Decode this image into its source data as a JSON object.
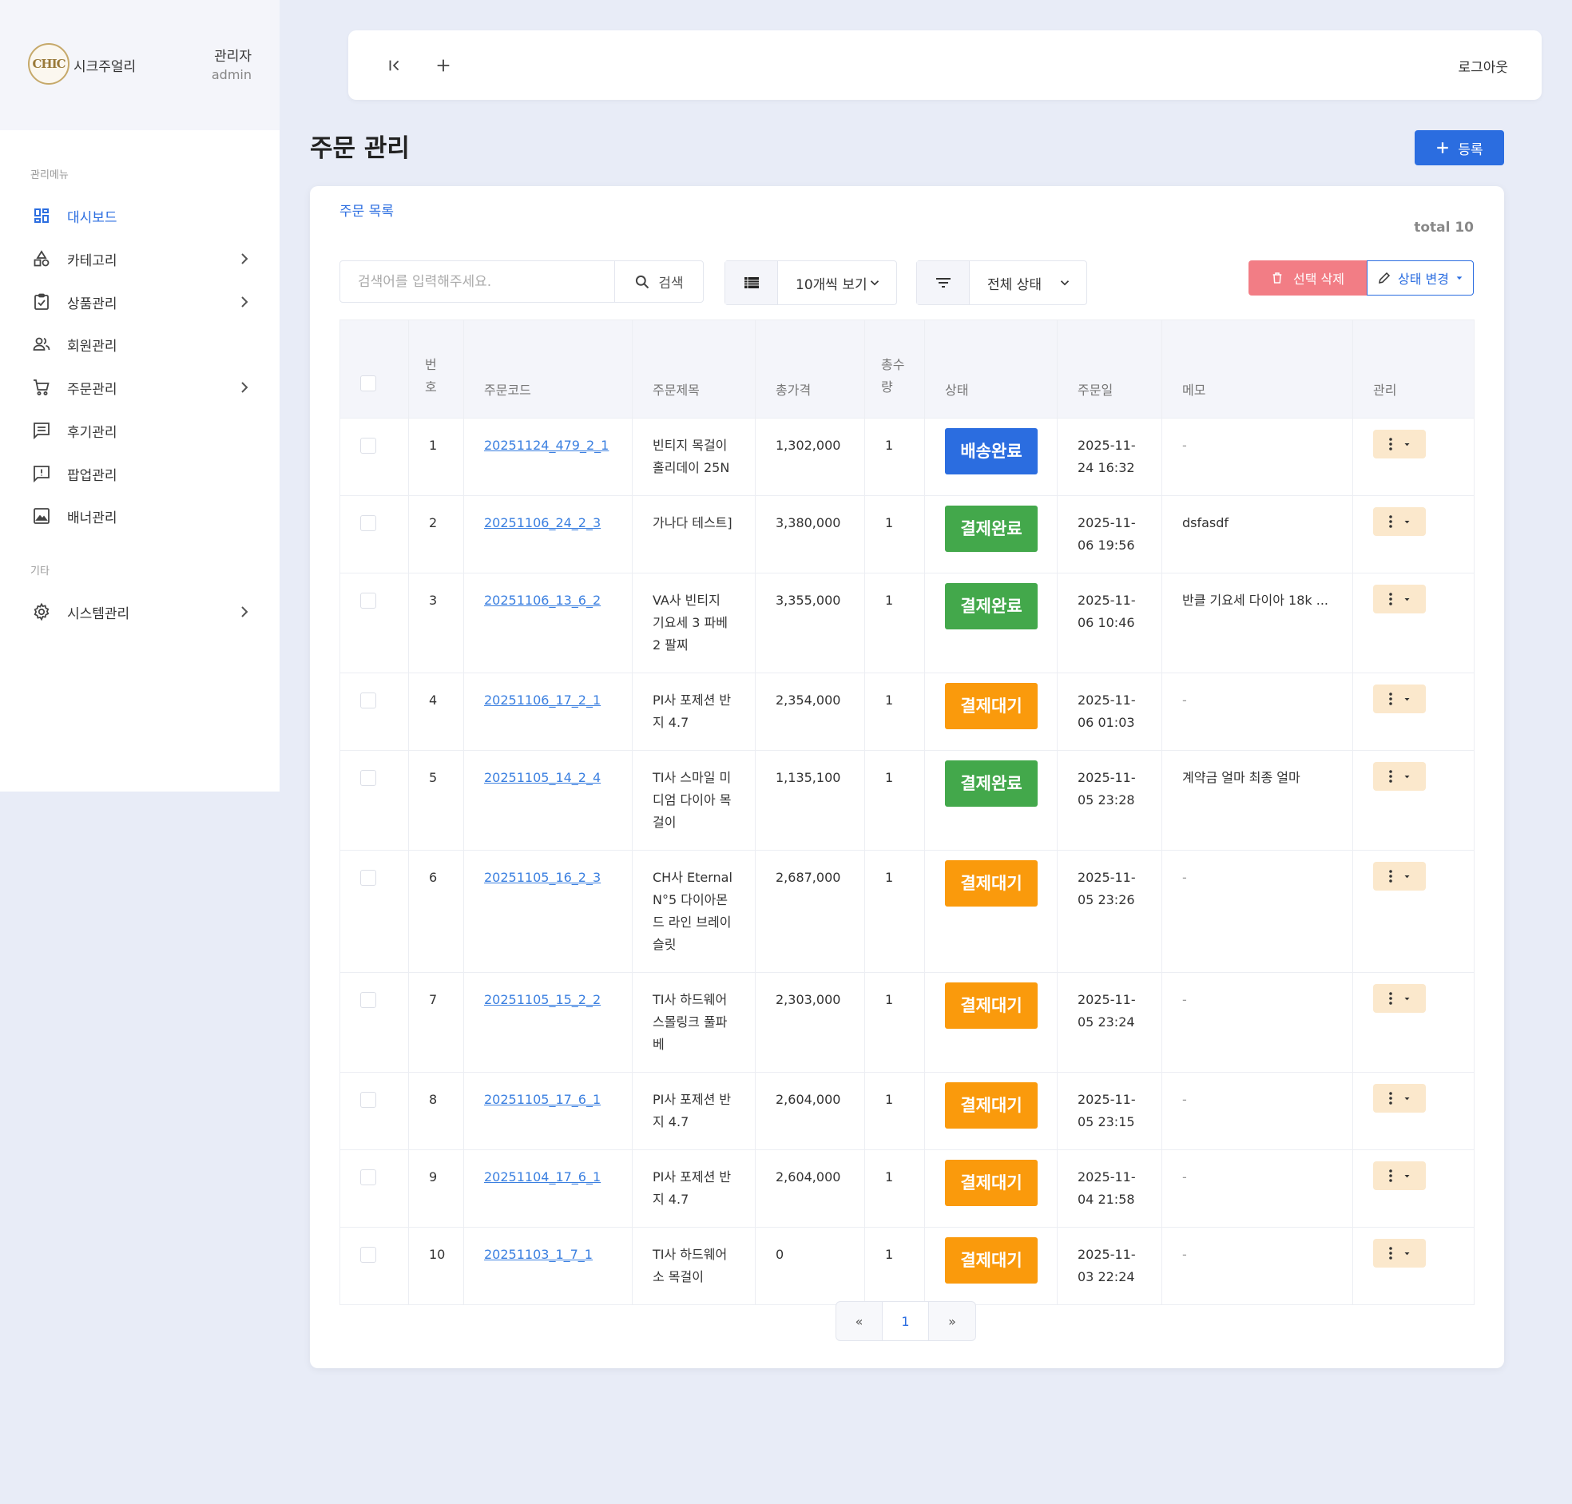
{
  "brand": {
    "logo_text": "CHIC",
    "name": "시크주얼리"
  },
  "user": {
    "role": "관리자",
    "id": "admin"
  },
  "sidebar": {
    "section_main": "관리메뉴",
    "section_other": "기타",
    "items": [
      {
        "label": "대시보드",
        "icon": "dashboard-icon",
        "active": true
      },
      {
        "label": "카테고리",
        "icon": "category-icon",
        "expandable": true
      },
      {
        "label": "상품관리",
        "icon": "clipboard-icon",
        "expandable": true
      },
      {
        "label": "회원관리",
        "icon": "people-icon",
        "expandable": false
      },
      {
        "label": "주문관리",
        "icon": "cart-icon",
        "expandable": true
      },
      {
        "label": "후기관리",
        "icon": "review-icon",
        "expandable": false
      },
      {
        "label": "팝업관리",
        "icon": "popup-icon",
        "expandable": false
      },
      {
        "label": "배너관리",
        "icon": "image-icon",
        "expandable": false
      },
      {
        "label": "시스템관리",
        "icon": "gear-icon",
        "expandable": true
      }
    ]
  },
  "topbar": {
    "logout_label": "로그아웃"
  },
  "page": {
    "title": "주문 관리",
    "register_label": "등록"
  },
  "card": {
    "title": "주문 목록",
    "total_label": "total 10",
    "search": {
      "placeholder": "검색어를 입력해주세요.",
      "button_label": "검색"
    },
    "page_size_label": "10개씩 보기",
    "status_filter_label": "전체 상태",
    "delete_selected_label": "선택 삭제",
    "change_status_label": "상태 변경"
  },
  "table": {
    "headers": [
      "",
      "번호",
      "주문코드",
      "주문제목",
      "총가격",
      "총수량",
      "상태",
      "주문일",
      "메모",
      "관리"
    ],
    "rows": [
      {
        "no": "1",
        "code": "20251124_479_2_1",
        "title": "빈티지 목걸이 홀리데이 25N",
        "price": "1,302,000",
        "qty": "1",
        "status": "배송완료",
        "status_color": "#2b6de0",
        "date": "2025-11-24 16:32",
        "memo": "-"
      },
      {
        "no": "2",
        "code": "20251106_24_2_3",
        "title": "가나다 테스트]",
        "price": "3,380,000",
        "qty": "1",
        "status": "결제완료",
        "status_color": "#43a84b",
        "date": "2025-11-06 19:56",
        "memo": "dsfasdf"
      },
      {
        "no": "3",
        "code": "20251106_13_6_2",
        "title": "VA사 빈티지 기요세 3 파베 2 팔찌",
        "price": "3,355,000",
        "qty": "1",
        "status": "결제완료",
        "status_color": "#43a84b",
        "date": "2025-11-06 10:46",
        "memo": "반클 기요세 다이아 18k ..."
      },
      {
        "no": "4",
        "code": "20251106_17_2_1",
        "title": "PI사 포제션 반지 4.7",
        "price": "2,354,000",
        "qty": "1",
        "status": "결제대기",
        "status_color": "#fa9a0c",
        "date": "2025-11-06 01:03",
        "memo": "-"
      },
      {
        "no": "5",
        "code": "20251105_14_2_4",
        "title": "TI사 스마일 미디엄 다이아 목걸이",
        "price": "1,135,100",
        "qty": "1",
        "status": "결제완료",
        "status_color": "#43a84b",
        "date": "2025-11-05 23:28",
        "memo": "계약금 얼마 최종 얼마"
      },
      {
        "no": "6",
        "code": "20251105_16_2_3",
        "title": "CH사 Eternal N°5 다이아몬드 라인 브레이슬릿",
        "price": "2,687,000",
        "qty": "1",
        "status": "결제대기",
        "status_color": "#fa9a0c",
        "date": "2025-11-05 23:26",
        "memo": "-"
      },
      {
        "no": "7",
        "code": "20251105_15_2_2",
        "title": "TI사 하드웨어 스몰링크 풀파베",
        "price": "2,303,000",
        "qty": "1",
        "status": "결제대기",
        "status_color": "#fa9a0c",
        "date": "2025-11-05 23:24",
        "memo": "-"
      },
      {
        "no": "8",
        "code": "20251105_17_6_1",
        "title": "PI사 포제션 반지 4.7",
        "price": "2,604,000",
        "qty": "1",
        "status": "결제대기",
        "status_color": "#fa9a0c",
        "date": "2025-11-05 23:15",
        "memo": "-"
      },
      {
        "no": "9",
        "code": "20251104_17_6_1",
        "title": "PI사 포제션 반지 4.7",
        "price": "2,604,000",
        "qty": "1",
        "status": "결제대기",
        "status_color": "#fa9a0c",
        "date": "2025-11-04 21:58",
        "memo": "-"
      },
      {
        "no": "10",
        "code": "20251103_1_7_1",
        "title": "TI사 하드웨어 소 목걸이",
        "price": "0",
        "qty": "1",
        "status": "결제대기",
        "status_color": "#fa9a0c",
        "date": "2025-11-03 22:24",
        "memo": "-"
      }
    ]
  },
  "pagination": {
    "prev": "«",
    "current": "1",
    "next": "»"
  },
  "colors": {
    "accent": "#2b6de0",
    "delete": "#f27d85",
    "paid": "#43a84b",
    "pending": "#fa9a0c",
    "background": "#e8ecf7"
  }
}
